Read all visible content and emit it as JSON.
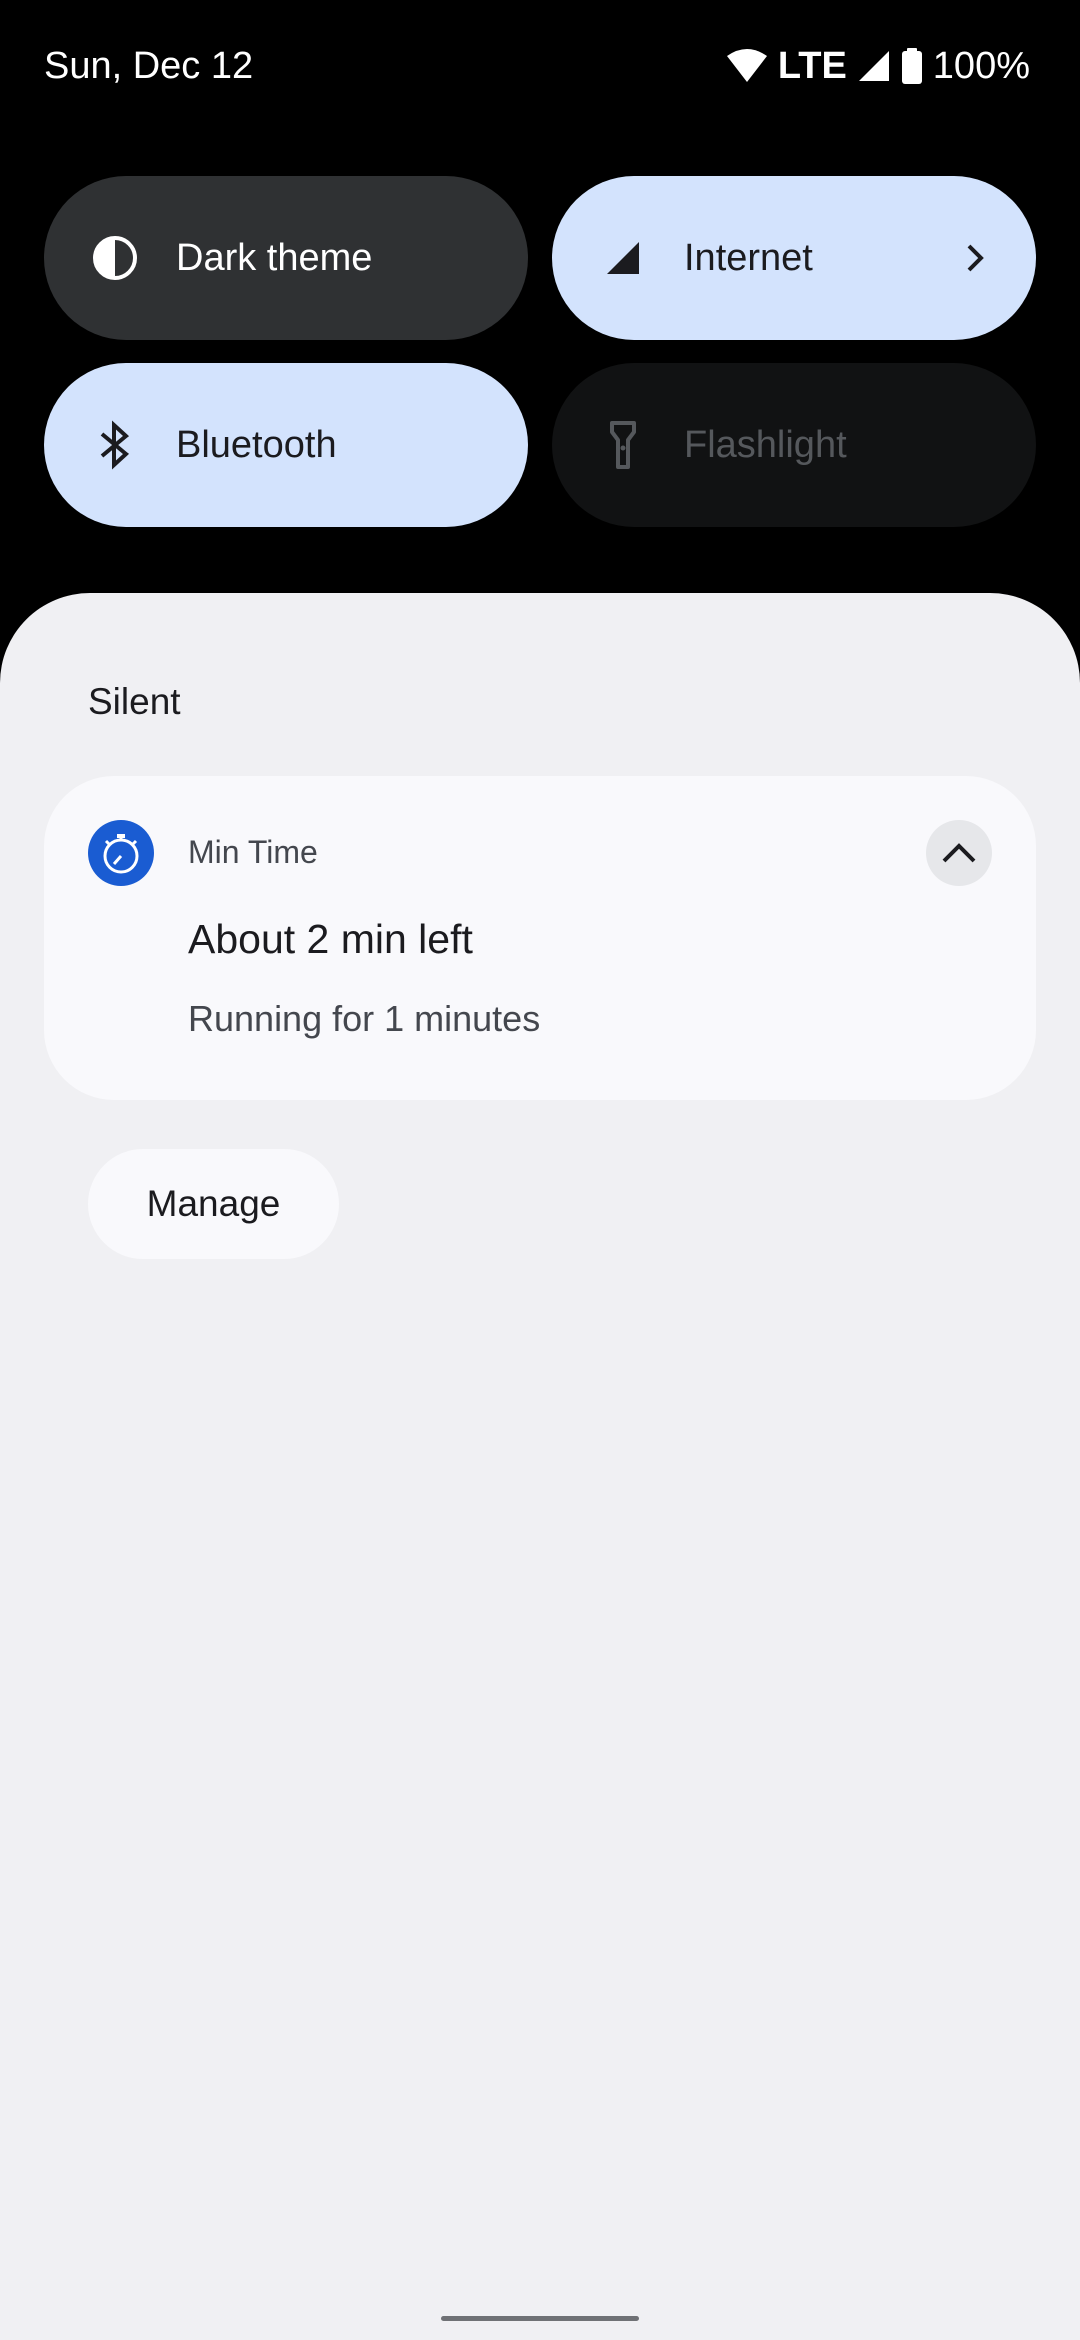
{
  "status_bar": {
    "date": "Sun, Dec 12",
    "network": "LTE",
    "battery": "100%",
    "icons": [
      "wifi-icon",
      "cell-signal-icon",
      "battery-icon"
    ]
  },
  "quick_settings": {
    "tiles": [
      {
        "label": "Dark theme",
        "state": "off",
        "icon": "dark-theme-icon"
      },
      {
        "label": "Internet",
        "state": "on",
        "icon": "cell-signal-icon",
        "has_chevron": true
      },
      {
        "label": "Bluetooth",
        "state": "on",
        "icon": "bluetooth-icon"
      },
      {
        "label": "Flashlight",
        "state": "unavailable",
        "icon": "flashlight-icon"
      }
    ]
  },
  "notifications": {
    "section_title": "Silent",
    "items": [
      {
        "app_name": "Min Time",
        "app_icon": "stopwatch-icon",
        "title": "About 2 min left",
        "text": "Running for 1 minutes"
      }
    ],
    "manage_label": "Manage"
  },
  "colors": {
    "tile_active": "#d3e3fd",
    "tile_inactive": "#2f3133",
    "tile_unavailable": "#111213",
    "shade_background": "#f0f0f3",
    "app_icon": "#1a5cd2"
  }
}
